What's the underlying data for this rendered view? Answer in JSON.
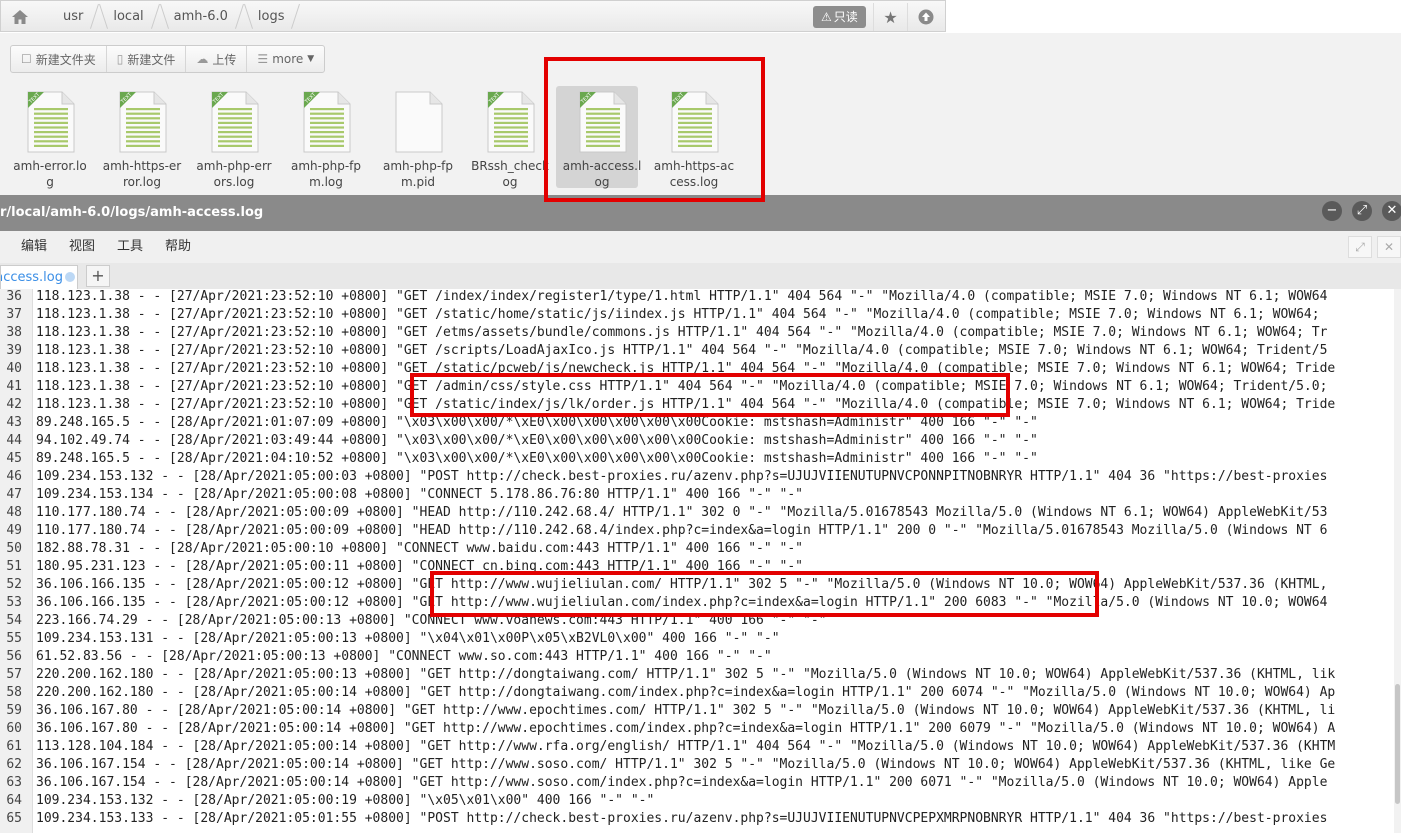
{
  "breadcrumb": {
    "items": [
      "usr",
      "local",
      "amh-6.0",
      "logs"
    ]
  },
  "header_buttons": {
    "readonly": "只读"
  },
  "toolbar": [
    {
      "icon": "folder-icon",
      "label": "新建文件夹"
    },
    {
      "icon": "file-icon",
      "label": "新建文件"
    },
    {
      "icon": "cloud-upload-icon",
      "label": "上传"
    },
    {
      "icon": "list-icon",
      "label": "more"
    }
  ],
  "files": [
    {
      "line1": "amh-error.lo",
      "line2": "g",
      "type": "text"
    },
    {
      "line1": "amh-https-er",
      "line2": "ror.log",
      "type": "text"
    },
    {
      "line1": "amh-php-err",
      "line2": "ors.log",
      "type": "text"
    },
    {
      "line1": "amh-php-fp",
      "line2": "m.log",
      "type": "text"
    },
    {
      "line1": "amh-php-fp",
      "line2": "m.pid",
      "type": "blank"
    },
    {
      "line1": "BRssh_check",
      "line2": "og",
      "type": "text"
    },
    {
      "line1": "amh-access.l",
      "line2": "og",
      "type": "text",
      "selected": true
    },
    {
      "line1": "amh-https-ac",
      "line2": "cess.log",
      "type": "text"
    }
  ],
  "editor": {
    "title": "r/local/amh-6.0/logs/amh-access.log",
    "menus": [
      "编辑",
      "视图",
      "工具",
      "帮助"
    ],
    "tab": "access.log",
    "tab_add": "+"
  },
  "log_lines": [
    {
      "n": "36",
      "t": "118.123.1.38 - - [27/Apr/2021:23:52:10 +0800] \"GET /index/index/register1/type/1.html HTTP/1.1\" 404 564 \"-\" \"Mozilla/4.0 (compatible; MSIE 7.0; Windows NT 6.1; WOW64"
    },
    {
      "n": "37",
      "t": "118.123.1.38 - - [27/Apr/2021:23:52:10 +0800] \"GET /static/home/static/js/iindex.js HTTP/1.1\" 404 564 \"-\" \"Mozilla/4.0 (compatible; MSIE 7.0; Windows NT 6.1; WOW64;"
    },
    {
      "n": "38",
      "t": "118.123.1.38 - - [27/Apr/2021:23:52:10 +0800] \"GET /etms/assets/bundle/commons.js HTTP/1.1\" 404 564 \"-\" \"Mozilla/4.0 (compatible; MSIE 7.0; Windows NT 6.1; WOW64; Tr"
    },
    {
      "n": "39",
      "t": "118.123.1.38 - - [27/Apr/2021:23:52:10 +0800] \"GET /scripts/LoadAjaxIco.js HTTP/1.1\" 404 564 \"-\" \"Mozilla/4.0 (compatible; MSIE 7.0; Windows NT 6.1; WOW64; Trident/5"
    },
    {
      "n": "40",
      "t": "118.123.1.38 - - [27/Apr/2021:23:52:10 +0800] \"GET /static/pcweb/js/newcheck.js HTTP/1.1\" 404 564 \"-\" \"Mozilla/4.0 (compatible; MSIE 7.0; Windows NT 6.1; WOW64; Tride"
    },
    {
      "n": "41",
      "t": "118.123.1.38 - - [27/Apr/2021:23:52:10 +0800] \"GET /admin/css/style.css HTTP/1.1\" 404 564 \"-\" \"Mozilla/4.0 (compatible; MSIE 7.0; Windows NT 6.1; WOW64; Trident/5.0;"
    },
    {
      "n": "42",
      "t": "118.123.1.38 - - [27/Apr/2021:23:52:10 +0800] \"GET /static/index/js/lk/order.js HTTP/1.1\" 404 564 \"-\" \"Mozilla/4.0 (compatible; MSIE 7.0; Windows NT 6.1; WOW64; Tride"
    },
    {
      "n": "43",
      "t": "89.248.165.5 - - [28/Apr/2021:01:07:09 +0800] \"\\x03\\x00\\x00/*\\xE0\\x00\\x00\\x00\\x00\\x00Cookie: mstshash=Administr\" 400 166 \"-\" \"-\""
    },
    {
      "n": "44",
      "t": "94.102.49.74 - - [28/Apr/2021:03:49:44 +0800] \"\\x03\\x00\\x00/*\\xE0\\x00\\x00\\x00\\x00\\x00Cookie: mstshash=Administr\" 400 166 \"-\" \"-\""
    },
    {
      "n": "45",
      "t": "89.248.165.5 - - [28/Apr/2021:04:10:52 +0800] \"\\x03\\x00\\x00/*\\xE0\\x00\\x00\\x00\\x00\\x00Cookie: mstshash=Administr\" 400 166 \"-\" \"-\""
    },
    {
      "n": "46",
      "t": "109.234.153.132 - - [28/Apr/2021:05:00:03 +0800] \"POST http://check.best-proxies.ru/azenv.php?s=UJUJVIIENUTUPNVCPONNPITNOBNRYR HTTP/1.1\" 404 36 \"https://best-proxies"
    },
    {
      "n": "47",
      "t": "109.234.153.134 - - [28/Apr/2021:05:00:08 +0800] \"CONNECT 5.178.86.76:80 HTTP/1.1\" 400 166 \"-\" \"-\""
    },
    {
      "n": "48",
      "t": "110.177.180.74 - - [28/Apr/2021:05:00:09 +0800] \"HEAD http://110.242.68.4/ HTTP/1.1\" 302 0 \"-\" \"Mozilla/5.01678543 Mozilla/5.0 (Windows NT 6.1; WOW64) AppleWebKit/53"
    },
    {
      "n": "49",
      "t": "110.177.180.74 - - [28/Apr/2021:05:00:09 +0800] \"HEAD http://110.242.68.4/index.php?c=index&a=login HTTP/1.1\" 200 0 \"-\" \"Mozilla/5.01678543 Mozilla/5.0 (Windows NT 6"
    },
    {
      "n": "50",
      "t": "182.88.78.31 - - [28/Apr/2021:05:00:10 +0800] \"CONNECT www.baidu.com:443 HTTP/1.1\" 400 166 \"-\" \"-\""
    },
    {
      "n": "51",
      "t": "180.95.231.123 - - [28/Apr/2021:05:00:11 +0800] \"CONNECT cn.bing.com:443 HTTP/1.1\" 400 166 \"-\" \"-\""
    },
    {
      "n": "52",
      "t": "36.106.166.135 - - [28/Apr/2021:05:00:12 +0800] \"GET http://www.wujieliulan.com/ HTTP/1.1\" 302 5 \"-\" \"Mozilla/5.0 (Windows NT 10.0; WOW64) AppleWebKit/537.36 (KHTML,"
    },
    {
      "n": "53",
      "t": "36.106.166.135 - - [28/Apr/2021:05:00:12 +0800] \"GET http://www.wujieliulan.com/index.php?c=index&a=login HTTP/1.1\" 200 6083 \"-\" \"Mozilla/5.0 (Windows NT 10.0; WOW64"
    },
    {
      "n": "54",
      "t": "223.166.74.29 - - [28/Apr/2021:05:00:13 +0800] \"CONNECT www.voanews.com:443 HTTP/1.1\" 400 166 \"-\" \"-\""
    },
    {
      "n": "55",
      "t": "109.234.153.131 - - [28/Apr/2021:05:00:13 +0800] \"\\x04\\x01\\x00P\\x05\\xB2VL0\\x00\" 400 166 \"-\" \"-\""
    },
    {
      "n": "56",
      "t": "61.52.83.56 - - [28/Apr/2021:05:00:13 +0800] \"CONNECT www.so.com:443 HTTP/1.1\" 400 166 \"-\" \"-\""
    },
    {
      "n": "57",
      "t": "220.200.162.180 - - [28/Apr/2021:05:00:13 +0800] \"GET http://dongtaiwang.com/ HTTP/1.1\" 302 5 \"-\" \"Mozilla/5.0 (Windows NT 10.0; WOW64) AppleWebKit/537.36 (KHTML, lik"
    },
    {
      "n": "58",
      "t": "220.200.162.180 - - [28/Apr/2021:05:00:14 +0800] \"GET http://dongtaiwang.com/index.php?c=index&a=login HTTP/1.1\" 200 6074 \"-\" \"Mozilla/5.0 (Windows NT 10.0; WOW64) Ap"
    },
    {
      "n": "59",
      "t": "36.106.167.80 - - [28/Apr/2021:05:00:14 +0800] \"GET http://www.epochtimes.com/ HTTP/1.1\" 302 5 \"-\" \"Mozilla/5.0 (Windows NT 10.0; WOW64) AppleWebKit/537.36 (KHTML, li"
    },
    {
      "n": "60",
      "t": "36.106.167.80 - - [28/Apr/2021:05:00:14 +0800] \"GET http://www.epochtimes.com/index.php?c=index&a=login HTTP/1.1\" 200 6079 \"-\" \"Mozilla/5.0 (Windows NT 10.0; WOW64) A"
    },
    {
      "n": "61",
      "t": "113.128.104.184 - - [28/Apr/2021:05:00:14 +0800] \"GET http://www.rfa.org/english/ HTTP/1.1\" 404 564 \"-\" \"Mozilla/5.0 (Windows NT 10.0; WOW64) AppleWebKit/537.36 (KHTM"
    },
    {
      "n": "62",
      "t": "36.106.167.154 - - [28/Apr/2021:05:00:14 +0800] \"GET http://www.soso.com/ HTTP/1.1\" 302 5 \"-\" \"Mozilla/5.0 (Windows NT 10.0; WOW64) AppleWebKit/537.36 (KHTML, like Ge"
    },
    {
      "n": "63",
      "t": "36.106.167.154 - - [28/Apr/2021:05:00:14 +0800] \"GET http://www.soso.com/index.php?c=index&a=login HTTP/1.1\" 200 6071 \"-\" \"Mozilla/5.0 (Windows NT 10.0; WOW64) Apple"
    },
    {
      "n": "64",
      "t": "109.234.153.132 - - [28/Apr/2021:05:00:19 +0800] \"\\x05\\x01\\x00\" 400 166 \"-\" \"-\""
    },
    {
      "n": "65",
      "t": "109.234.153.133 - - [28/Apr/2021:05:01:55 +0800] \"POST http://check.best-proxies.ru/azenv.php?s=UJUJVIIENUTUPNVCPEPXMRPNOBNRYR HTTP/1.1\" 404 36 \"https://best-proxies"
    }
  ]
}
